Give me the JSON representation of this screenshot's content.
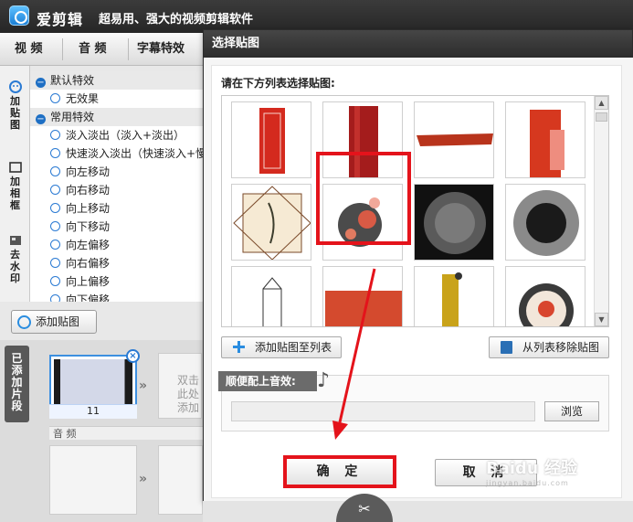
{
  "app": {
    "name": "爱剪辑",
    "slogan": "超易用、强大的视频剪辑软件"
  },
  "tabs": [
    {
      "label": "视 频"
    },
    {
      "label": "音 频"
    },
    {
      "label": "字幕特效"
    }
  ],
  "side_tools": [
    {
      "label": "加贴图",
      "icon": "sticker-icon"
    },
    {
      "label": "加相框",
      "icon": "frame-icon"
    },
    {
      "label": "去水印",
      "icon": "watermark-icon"
    }
  ],
  "effects": {
    "groups": [
      {
        "title": "默认特效",
        "items": [
          "无效果"
        ]
      },
      {
        "title": "常用特效",
        "items": [
          "淡入淡出（淡入+淡出）",
          "快速淡入淡出（快速淡入+慢",
          "向左移动",
          "向右移动",
          "向上移动",
          "向下移动",
          "向左偏移",
          "向右偏移",
          "向上偏移",
          "向下偏移"
        ]
      }
    ]
  },
  "add_sticker_label": "添加贴图",
  "clips": {
    "tab_label": "已添加片段",
    "items": [
      {
        "number": "11"
      }
    ],
    "drop_hint": "双击此处添加"
  },
  "audio_track_label": "音 频",
  "dialog": {
    "title": "选择贴图",
    "prompt": "请在下方列表选择贴图:",
    "add_to_list": "添加贴图至列表",
    "remove_from_list": "从列表移除贴图",
    "audio_label": "顺便配上音效:",
    "audio_path": "",
    "browse": "浏览",
    "ok": "确 定",
    "cancel": "取 消"
  },
  "watermark": {
    "text": "Baidu 经验",
    "sub": "jingyan.baidu.com"
  },
  "colors": {
    "highlight": "#e4131b",
    "accent": "#2a7ad3",
    "titlebar": "#2c2c2c"
  }
}
